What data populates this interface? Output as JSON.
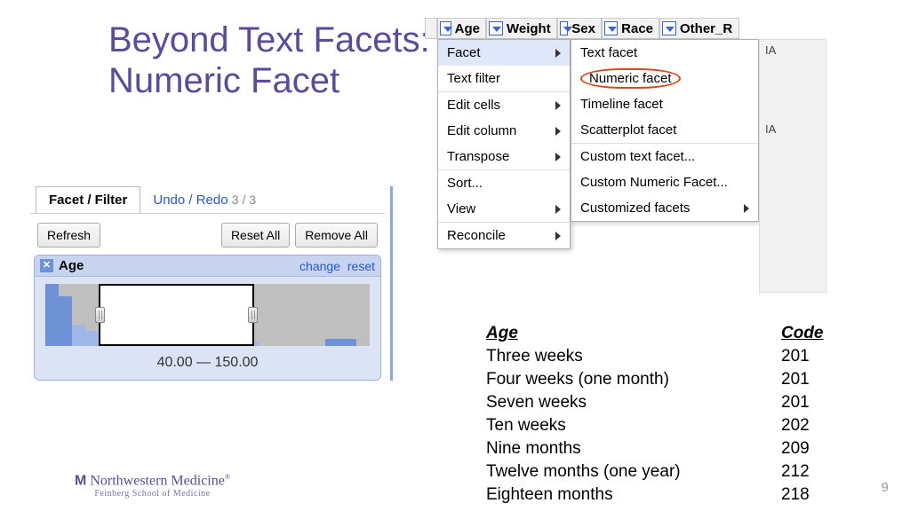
{
  "title_line1": "Beyond Text Facets:",
  "title_line2": "Numeric Facet",
  "panel": {
    "tab_active": "Facet / Filter",
    "tab_link": "Undo / Redo",
    "undo_count": "3 / 3",
    "refresh": "Refresh",
    "reset_all": "Reset All",
    "remove_all": "Remove All",
    "facet_name": "Age",
    "change": "change",
    "reset": "reset",
    "range": "40.00 — 150.00"
  },
  "columns": [
    "Age",
    "Weight",
    "Sex",
    "Race",
    "Other_R"
  ],
  "menu": [
    {
      "label": "Facet",
      "arrow": true,
      "active": true
    },
    {
      "label": "Text filter",
      "arrow": false
    },
    {
      "label": "Edit cells",
      "arrow": true,
      "sep": true
    },
    {
      "label": "Edit column",
      "arrow": true
    },
    {
      "label": "Transpose",
      "arrow": true
    },
    {
      "label": "Sort...",
      "arrow": false,
      "sep": true
    },
    {
      "label": "View",
      "arrow": true
    },
    {
      "label": "Reconcile",
      "arrow": true,
      "sep": true
    }
  ],
  "submenu": [
    {
      "label": "Text facet"
    },
    {
      "label": "Numeric facet",
      "circled": true
    },
    {
      "label": "Timeline facet"
    },
    {
      "label": "Scatterplot facet"
    },
    {
      "label": "Custom text facet...",
      "sep": true
    },
    {
      "label": "Custom Numeric Facet..."
    },
    {
      "label": "Customized facets",
      "arrow": true
    }
  ],
  "codetable": {
    "headers": [
      "Age",
      "Code"
    ],
    "rows": [
      [
        "Three weeks",
        "201"
      ],
      [
        "Four weeks (one month)",
        "201"
      ],
      [
        "Seven weeks",
        "201"
      ],
      [
        "Ten weeks",
        "202"
      ],
      [
        "Nine months",
        "209"
      ],
      [
        "Twelve months (one year)",
        "212"
      ],
      [
        "Eighteen months",
        "218"
      ]
    ]
  },
  "footer": {
    "logo_text": "Northwestern Medicine",
    "sub": "Feinberg School of Medicine",
    "page": "9"
  }
}
